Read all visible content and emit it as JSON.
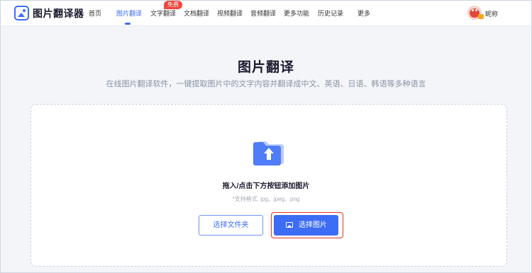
{
  "header": {
    "app_name": "图片翻译器",
    "nav": [
      {
        "label": "首页"
      },
      {
        "label": "图片翻译"
      },
      {
        "label": "文字翻译"
      },
      {
        "label": "文档翻译"
      },
      {
        "label": "视频翻译"
      },
      {
        "label": "音频翻译"
      },
      {
        "label": "更多功能"
      },
      {
        "label": "历史记录"
      },
      {
        "label": "更多"
      }
    ],
    "active_nav": "图片翻译",
    "badge": "免费",
    "username": "昵称"
  },
  "main": {
    "title": "图片翻译",
    "subtitle": "在线图片翻译软件，一键提取图片中的文字内容并翻译成中文、英语、日语、韩语等多种语言",
    "drop_title": "拖入/点击下方按钮添加图片",
    "drop_hint": "*支持格式: jpg、jpeg、png",
    "btn_folder": "选择文件夹",
    "btn_image": "选择图片"
  },
  "icons": {
    "logo": "image-translate-logo-icon",
    "folder": "folder-upload-icon",
    "image": "image-icon",
    "avatar": "user-avatar"
  },
  "colors": {
    "accent": "#3d6cf5",
    "badge": "#f0463c",
    "highlight": "#e0322c"
  }
}
